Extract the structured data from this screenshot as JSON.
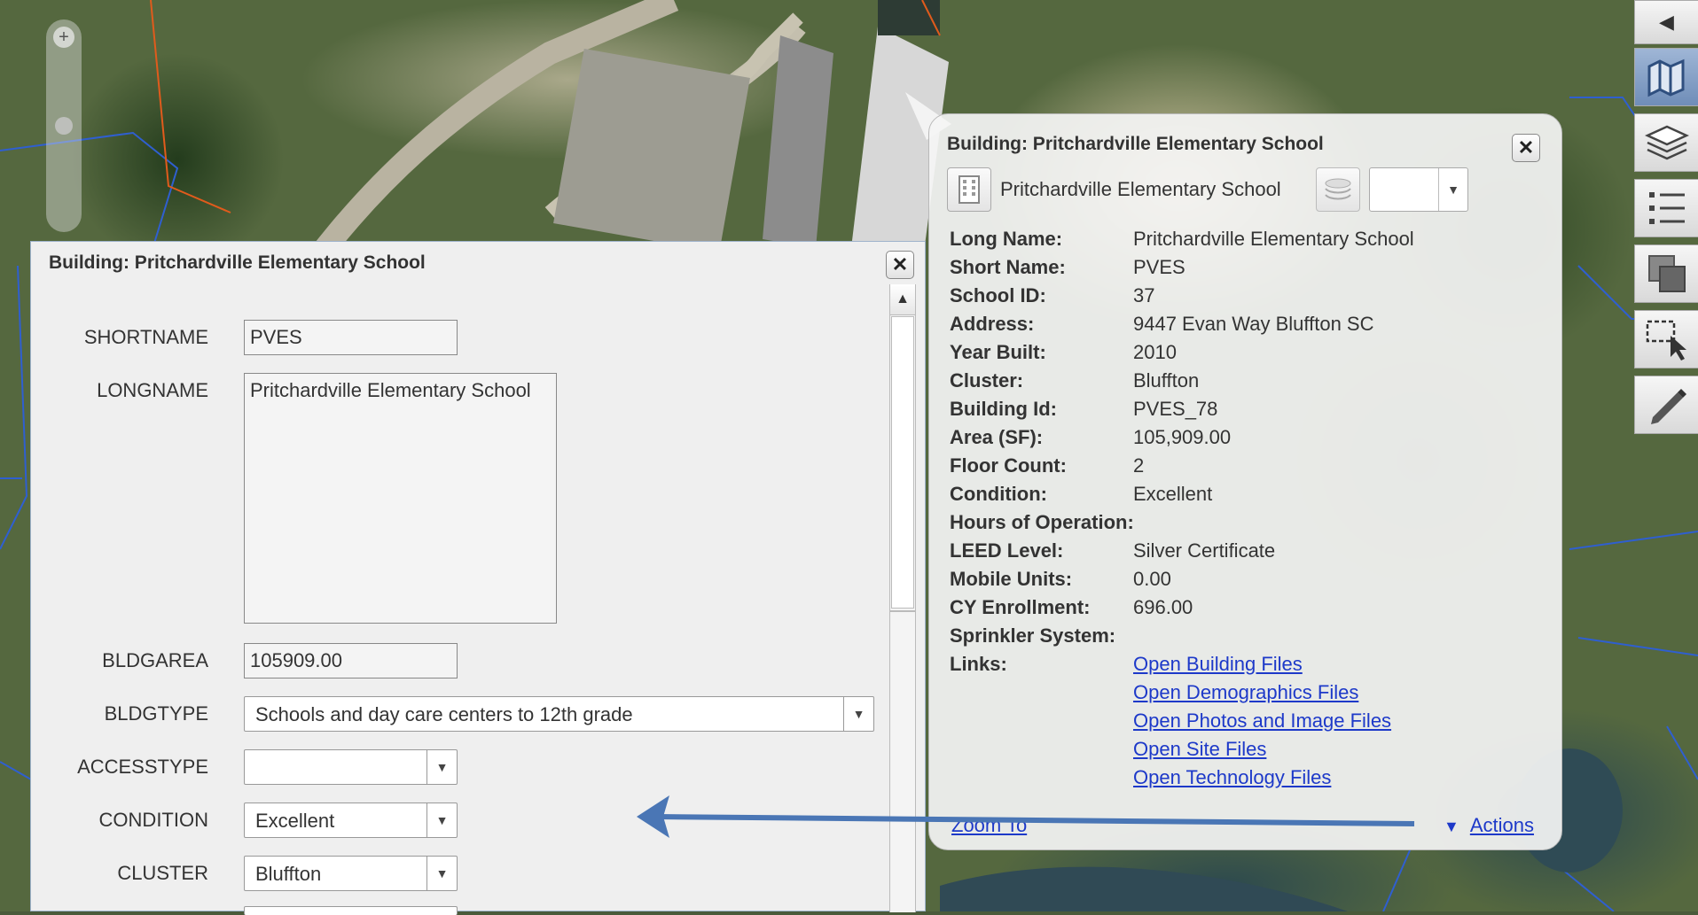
{
  "popup": {
    "title": "Building: Pritchardville Elementary School",
    "feature_name": "Pritchardville Elementary School",
    "layer_select_value": "",
    "close_glyph": "✕",
    "attributes": [
      {
        "label": "Long Name:",
        "value": "Pritchardville Elementary School"
      },
      {
        "label": "Short Name:",
        "value": "PVES"
      },
      {
        "label": "School ID:",
        "value": "37"
      },
      {
        "label": "Address:",
        "value": "9447 Evan Way Bluffton SC"
      },
      {
        "label": "Year Built:",
        "value": "2010"
      },
      {
        "label": "Cluster:",
        "value": "Bluffton"
      },
      {
        "label": "Building Id:",
        "value": "PVES_78"
      },
      {
        "label": "Area (SF):",
        "value": "105,909.00"
      },
      {
        "label": "Floor Count:",
        "value": "2"
      },
      {
        "label": "Condition:",
        "value": "Excellent"
      },
      {
        "label": "Hours of Operation:",
        "value": ""
      },
      {
        "label": "LEED Level:",
        "value": "Silver Certificate"
      },
      {
        "label": "Mobile Units:",
        "value": "0.00"
      },
      {
        "label": "CY Enrollment:",
        "value": "696.00"
      },
      {
        "label": "Sprinkler System:",
        "value": ""
      },
      {
        "label": "Links:",
        "value": ""
      }
    ],
    "links": [
      "Open Building Files",
      "Open Demographics Files",
      "Open Photos and Image Files",
      "Open Site Files",
      "Open Technology Files"
    ],
    "zoom_to": "Zoom To",
    "actions": "Actions"
  },
  "editor": {
    "title": "Building: Pritchardville Elementary School",
    "close_glyph": "✕",
    "scroll_up_glyph": "▲",
    "fields": {
      "shortname": {
        "label": "SHORTNAME",
        "value": "PVES"
      },
      "longname": {
        "label": "LONGNAME",
        "value": "Pritchardville Elementary School"
      },
      "bldgarea": {
        "label": "BLDGAREA",
        "value": "105909.00"
      },
      "bldgtype": {
        "label": "BLDGTYPE",
        "value": "Schools and day care centers to 12th grade"
      },
      "accesstype": {
        "label": "ACCESSTYPE",
        "value": ""
      },
      "condition": {
        "label": "CONDITION",
        "value": "Excellent"
      },
      "cluster": {
        "label": "CLUSTER",
        "value": "Bluffton"
      }
    }
  },
  "toolbar": {
    "collapse_glyph": "◀",
    "tools": [
      "basemap-icon",
      "layers-icon",
      "legend-icon",
      "overview-icon",
      "select-icon",
      "edit-icon"
    ]
  },
  "colors": {
    "link": "#1d39c9",
    "annotation_arrow": "#4a76b5",
    "parcel_lines": "#2f5fd0"
  }
}
